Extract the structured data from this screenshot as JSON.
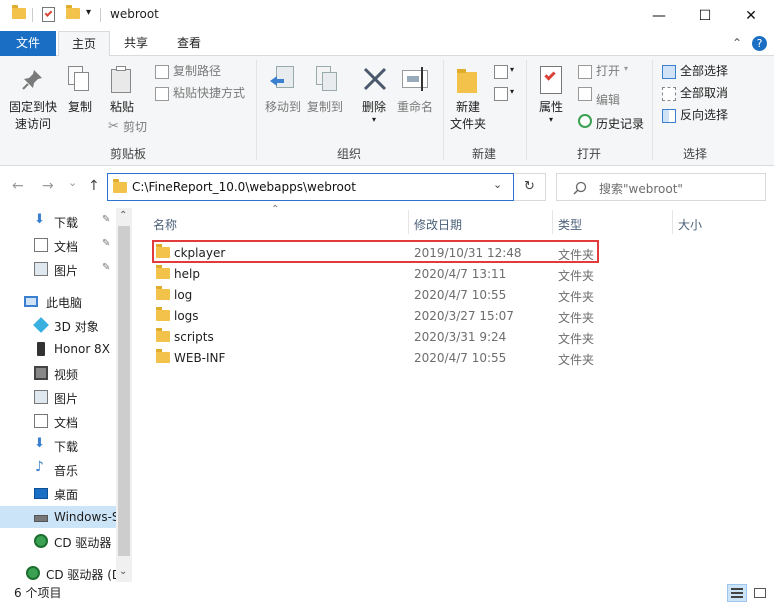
{
  "window": {
    "title": "webroot",
    "minimize_glyph": "—",
    "maximize_glyph": "☐",
    "close_glyph": "✕",
    "qat_dropdown_glyph": "▾"
  },
  "ribbon_tabs": {
    "file": "文件",
    "home": "主页",
    "share": "共享",
    "view": "查看"
  },
  "ribbon_misc": {
    "collapse_glyph": "⌃",
    "help_glyph": "?"
  },
  "ribbon": {
    "clipboard": {
      "group": "剪贴板",
      "pin_line1": "固定到快",
      "pin_line2": "速访问",
      "copy": "复制",
      "paste": "粘贴",
      "copy_path": "复制路径",
      "paste_shortcut": "粘贴快捷方式",
      "cut": "剪切"
    },
    "organize": {
      "group": "组织",
      "move_to": "移动到",
      "copy_to": "复制到",
      "delete": "删除",
      "rename": "重命名"
    },
    "new": {
      "group": "新建",
      "new_folder_line1": "新建",
      "new_folder_line2": "文件夹"
    },
    "open": {
      "group": "打开",
      "properties": "属性",
      "open": "打开",
      "edit": "编辑",
      "history": "历史记录"
    },
    "select": {
      "group": "选择",
      "select_all": "全部选择",
      "select_none": "全部取消",
      "invert": "反向选择"
    }
  },
  "navigation": {
    "back_glyph": "←",
    "forward_glyph": "→",
    "recent_glyph": "⌄",
    "up_glyph": "↑",
    "address": "C:\\FineReport_10.0\\webapps\\webroot",
    "address_dropdown_glyph": "⌄",
    "refresh_glyph": "↻",
    "search_placeholder": "搜索\"webroot\""
  },
  "sidebar": {
    "pin_glyph": "✎",
    "scroll_up_glyph": "⌃",
    "scroll_down_glyph": "⌄",
    "quick": [
      {
        "label": "下载"
      },
      {
        "label": "文档"
      },
      {
        "label": "图片"
      }
    ],
    "this_pc": "此电脑",
    "pc_items": [
      {
        "label": "3D 对象"
      },
      {
        "label": "Honor 8X"
      },
      {
        "label": "视频"
      },
      {
        "label": "图片"
      },
      {
        "label": "文档"
      },
      {
        "label": "下载"
      },
      {
        "label": "音乐"
      },
      {
        "label": "桌面"
      },
      {
        "label": "Windows-S"
      },
      {
        "label": "CD 驱动器"
      }
    ],
    "cd_drive": "CD 驱动器 (D"
  },
  "file_list": {
    "sort_glyph": "⌃",
    "columns": {
      "name": "名称",
      "modified": "修改日期",
      "type": "类型",
      "size": "大小"
    },
    "rows": [
      {
        "name": "ckplayer",
        "modified": "2019/10/31 12:48",
        "type": "文件夹"
      },
      {
        "name": "help",
        "modified": "2020/4/7 13:11",
        "type": "文件夹"
      },
      {
        "name": "log",
        "modified": "2020/4/7 10:55",
        "type": "文件夹"
      },
      {
        "name": "logs",
        "modified": "2020/3/27 15:07",
        "type": "文件夹"
      },
      {
        "name": "scripts",
        "modified": "2020/3/31 9:24",
        "type": "文件夹"
      },
      {
        "name": "WEB-INF",
        "modified": "2020/4/7 10:55",
        "type": "文件夹"
      }
    ]
  },
  "status": {
    "item_count": "6 个项目"
  },
  "colors": {
    "accent": "#1a6fc4",
    "highlight_border": "#e23b3b",
    "selection": "#cce4f7",
    "folder": "#f2c24b"
  }
}
